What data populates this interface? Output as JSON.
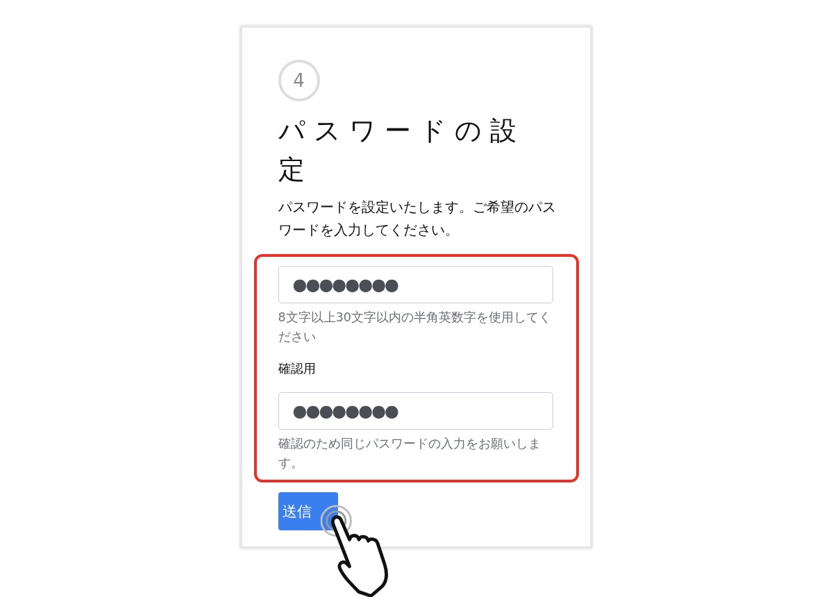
{
  "step": {
    "number": "4"
  },
  "title": "パスワードの設定",
  "description": "パスワードを設定いたします。ご希望のパスワードを入力してください。",
  "fields": [
    {
      "value": "●●●●●●●●",
      "hint": "8文字以上30文字以内の半角英数字を使用してください"
    },
    {
      "label": "確認用",
      "value": "●●●●●●●●",
      "hint": "確認のため同じパスワードの入力をお願いします。"
    }
  ],
  "submit": {
    "label": "送信"
  }
}
